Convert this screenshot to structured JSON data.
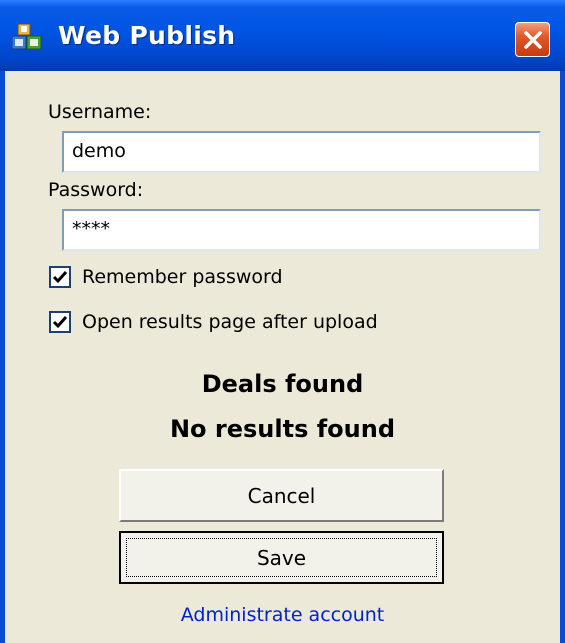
{
  "window": {
    "title": "Web Publish",
    "icon": "web-publish-app-icon",
    "close_icon": "close-icon"
  },
  "form": {
    "username_label": "Username:",
    "username_value": "demo",
    "password_label": "Password:",
    "password_value": "****",
    "remember_password_label": "Remember password",
    "remember_password_checked": true,
    "open_results_label": "Open results page after upload",
    "open_results_checked": true
  },
  "status": {
    "line1": "Deals found",
    "line2": "No results found"
  },
  "buttons": {
    "cancel_label": "Cancel",
    "save_label": "Save"
  },
  "links": {
    "administrate_label": "Administrate account"
  },
  "colors": {
    "titlebar": "#0054e3",
    "dialog_bg": "#ece9d8",
    "close_button": "#e05a2a",
    "link": "#0022cc"
  }
}
